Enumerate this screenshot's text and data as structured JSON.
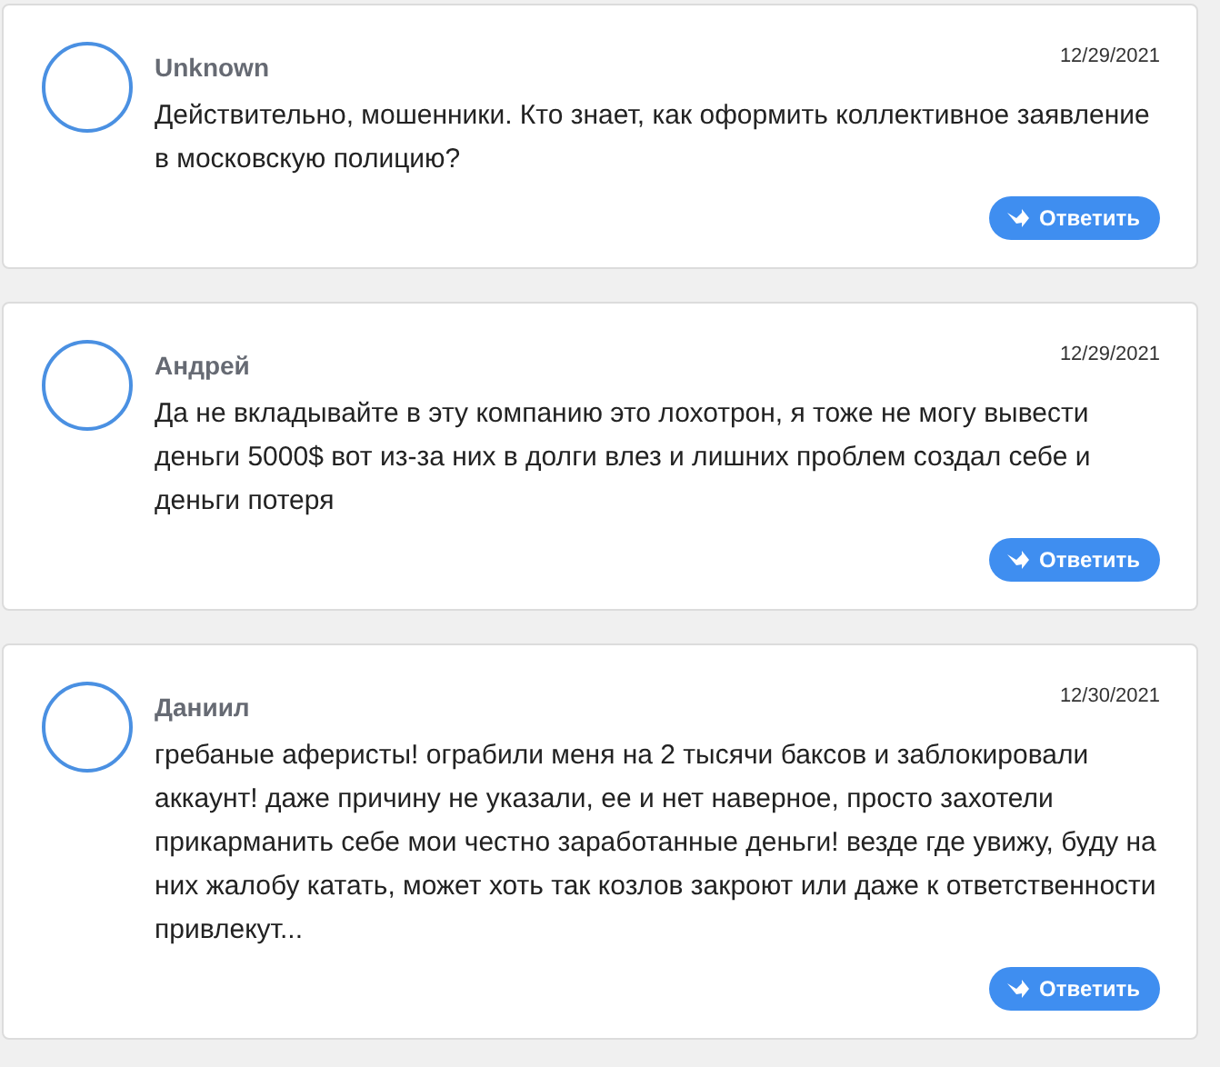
{
  "comments": [
    {
      "author": "Unknown",
      "date": "12/29/2021",
      "text": "Действительно, мошенники. Кто знает, как оформить коллективное заявление в московскую полицию?",
      "reply": "Ответить"
    },
    {
      "author": "Андрей",
      "date": "12/29/2021",
      "text": "Да не вкладывайте в эту компанию это лохотрон, я тоже не могу вывести деньги 5000$ вот из-за них в долги влез и лишних проблем создал себе и деньги потеря",
      "reply": "Ответить"
    },
    {
      "author": "Даниил",
      "date": "12/30/2021",
      "text": "гребаные аферисты! ограбили меня на 2 тысячи баксов и заблокировали аккаунт! даже причину не указали, ее и нет наверное, просто захотели прикарманить себе мои честно заработанные деньги! везде где увижу, буду на них жалобу катать, может хоть так козлов закроют или даже к ответственности привлекут...",
      "reply": "Ответить"
    }
  ]
}
